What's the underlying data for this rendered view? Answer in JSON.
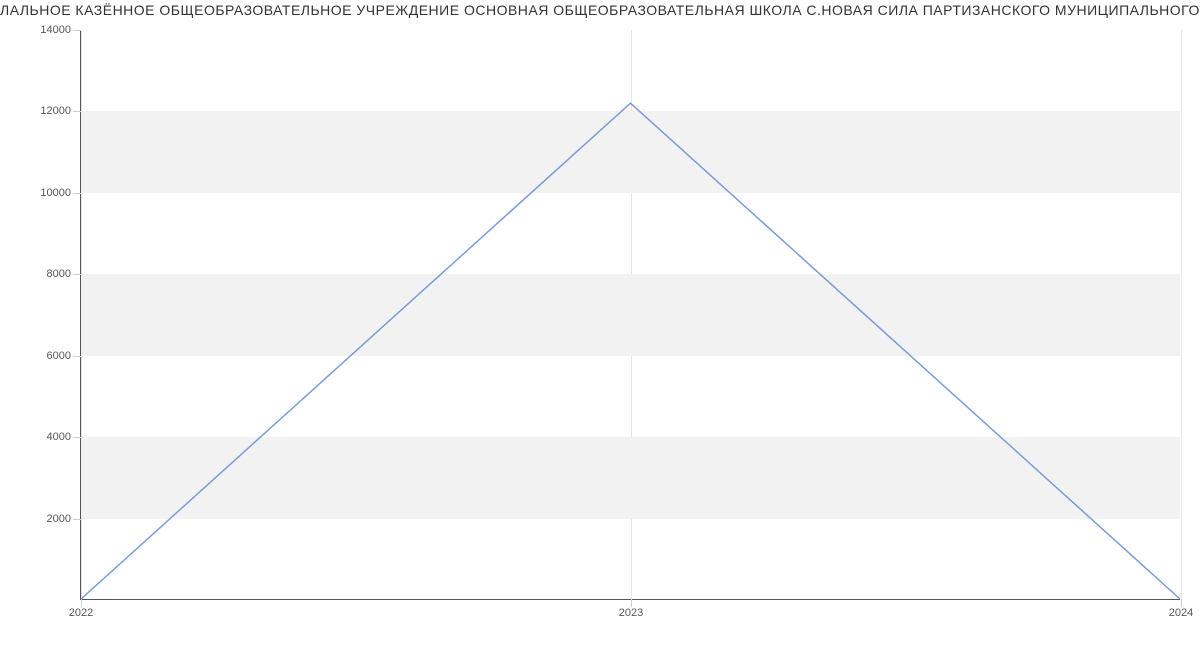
{
  "chart_data": {
    "type": "line",
    "title": "ЛАЛЬНОЕ КАЗЁННОЕ ОБЩЕОБРАЗОВАТЕЛЬНОЕ УЧРЕЖДЕНИЕ ОСНОВНАЯ ОБЩЕОБРАЗОВАТЕЛЬНАЯ ШКОЛА С.НОВАЯ СИЛА ПАРТИЗАНСКОГО МУНИЦИПАЛЬНОГО РАЙОНА",
    "x": [
      2022,
      2023,
      2024
    ],
    "values": [
      0,
      12200,
      0
    ],
    "xlim": [
      2022,
      2024
    ],
    "ylim": [
      0,
      14000
    ],
    "yticks": [
      2000,
      4000,
      6000,
      8000,
      10000,
      12000,
      14000
    ],
    "xlabel": "",
    "ylabel": "",
    "line_color": "#7a9bd8"
  }
}
